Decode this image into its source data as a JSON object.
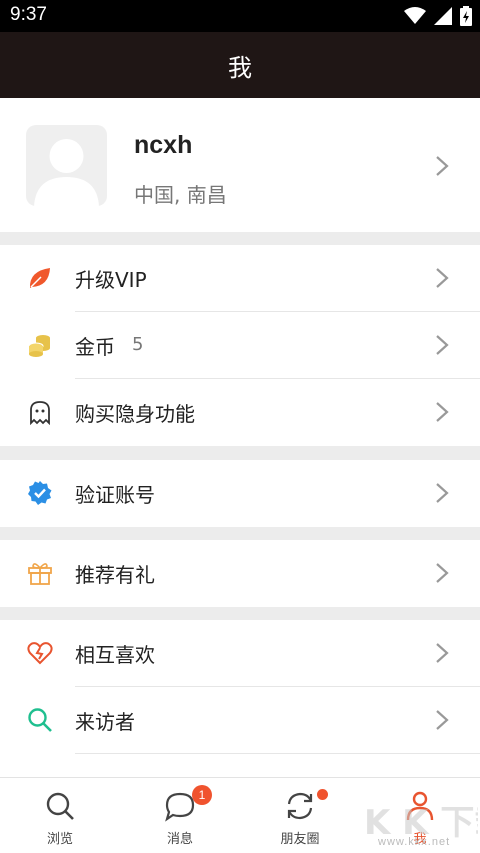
{
  "status_bar": {
    "time": "9:37"
  },
  "header": {
    "title": "我"
  },
  "profile": {
    "username": "ncxh",
    "location": "中国, 南昌"
  },
  "menu": {
    "group1": [
      {
        "label": "升级VIP",
        "icon": "leaf-icon",
        "value": ""
      },
      {
        "label": "金币",
        "icon": "coins-icon",
        "value": "5"
      },
      {
        "label": "购买隐身功能",
        "icon": "ghost-icon",
        "value": ""
      }
    ],
    "group2": [
      {
        "label": "验证账号",
        "icon": "verified-icon"
      }
    ],
    "group3": [
      {
        "label": "推荐有礼",
        "icon": "gift-icon"
      }
    ],
    "group4": [
      {
        "label": "相互喜欢",
        "icon": "heart-icon"
      },
      {
        "label": "来访者",
        "icon": "search-icon"
      }
    ]
  },
  "tab_bar": {
    "tabs": [
      {
        "label": "浏览",
        "icon": "browse-search-icon",
        "active": false
      },
      {
        "label": "消息",
        "icon": "message-icon",
        "active": false
      },
      {
        "label": "朋友圈",
        "icon": "refresh-icon",
        "active": false
      },
      {
        "label": "我",
        "icon": "person-icon",
        "active": true
      }
    ],
    "messages_badge": "1"
  },
  "watermark": {
    "text": "www.kkx.net"
  },
  "colors": {
    "accent": "#e8542f",
    "header_bg": "#1f1615",
    "vip": "#f0582c",
    "coins": "#e7c24a",
    "verified": "#2b8fe5",
    "gift": "#f0a54a",
    "heart": "#e8542f",
    "search": "#1fbf8f"
  }
}
